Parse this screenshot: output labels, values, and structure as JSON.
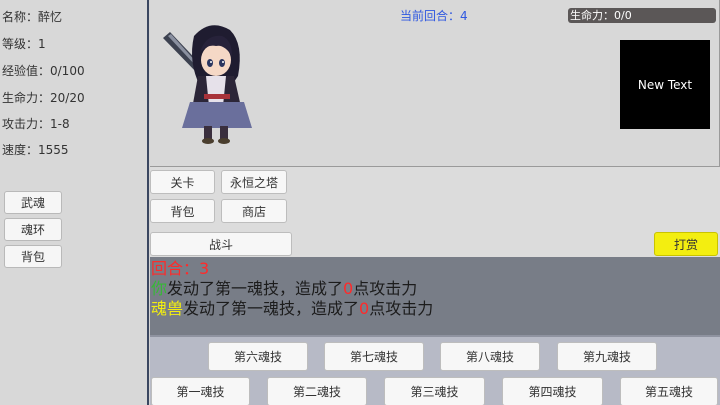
{
  "player": {
    "name": "名称：醉忆",
    "level": "等级：1",
    "exp": "经验值：0/100",
    "hp": "生命力：20/20",
    "attack": "攻击力：1-8",
    "speed": "速度：1555"
  },
  "side_menu": {
    "martial_soul": "武魂",
    "soul_ring": "魂环",
    "bag": "背包"
  },
  "battle": {
    "turn_label": "当前回合：4",
    "enemy_hp": {
      "label": "生命力：0/0",
      "fraction": 0
    },
    "enemy_text": "New Text"
  },
  "actions": {
    "stage": "关卡",
    "eternal_tower": "永恒之塔",
    "bag": "背包",
    "shop": "商店",
    "fight": "战斗",
    "reward": "打赏"
  },
  "log": {
    "round_label": "回合：",
    "round_value": "3",
    "line1": {
      "actor": "你",
      "text_a": "发动了第一魂技，造成了",
      "damage": "0",
      "text_b": "点攻击力"
    },
    "line2": {
      "actor": "魂兽",
      "text_a": "发动了第一魂技，造成了",
      "damage": "0",
      "text_b": "点攻击力"
    }
  },
  "skills": {
    "row_top": [
      "第六魂技",
      "第七魂技",
      "第八魂技",
      "第九魂技"
    ],
    "row_bottom": [
      "第一魂技",
      "第二魂技",
      "第三魂技",
      "第四魂技",
      "第五魂技"
    ]
  },
  "colors": {
    "turn_text": "#2f58e0",
    "hp_track": "#5b5757",
    "reward_button": "#f3ee10",
    "damage_red": "#ff2a2a",
    "player_green": "#36b836",
    "beast_yellow": "#f3ee10"
  }
}
